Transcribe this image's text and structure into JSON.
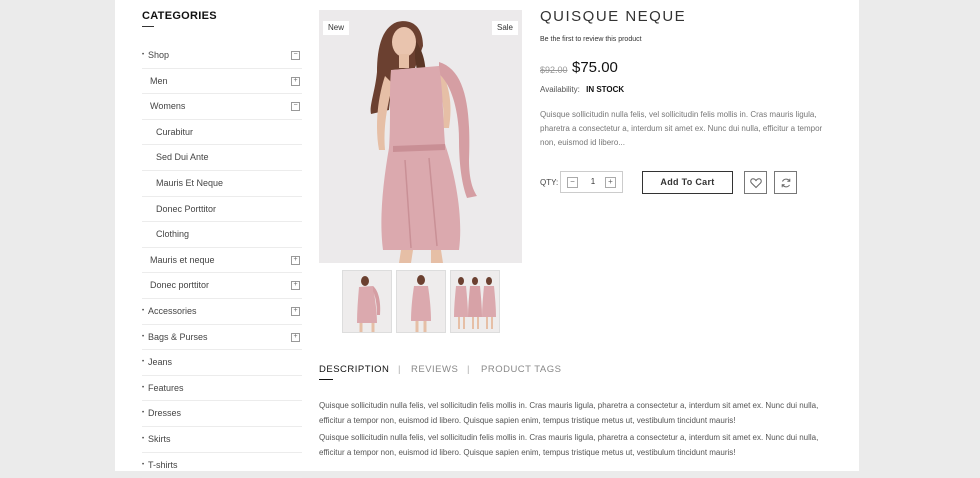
{
  "sidebar": {
    "title": "CATEGORIES",
    "items": [
      {
        "label": "Shop",
        "level": 0,
        "toggle": "minus"
      },
      {
        "label": "Men",
        "level": 1,
        "toggle": "plus"
      },
      {
        "label": "Womens",
        "level": 1,
        "toggle": "minus"
      },
      {
        "label": "Curabitur",
        "level": 2,
        "toggle": ""
      },
      {
        "label": "Sed Dui Ante",
        "level": 2,
        "toggle": ""
      },
      {
        "label": "Mauris Et Neque",
        "level": 2,
        "toggle": ""
      },
      {
        "label": "Donec Porttitor",
        "level": 2,
        "toggle": ""
      },
      {
        "label": "Clothing",
        "level": 2,
        "toggle": ""
      },
      {
        "label": "Mauris et neque",
        "level": 1,
        "toggle": "plus"
      },
      {
        "label": "Donec porttitor",
        "level": 1,
        "toggle": "plus"
      },
      {
        "label": "Accessories",
        "level": 0,
        "toggle": "plus"
      },
      {
        "label": "Bags & Purses",
        "level": 0,
        "toggle": "plus"
      },
      {
        "label": "Jeans",
        "level": 0,
        "toggle": ""
      },
      {
        "label": "Features",
        "level": 0,
        "toggle": ""
      },
      {
        "label": "Dresses",
        "level": 0,
        "toggle": ""
      },
      {
        "label": "Skirts",
        "level": 0,
        "toggle": ""
      },
      {
        "label": "T-shirts",
        "level": 0,
        "toggle": ""
      }
    ]
  },
  "gallery": {
    "badge_new": "New",
    "badge_sale": "Sale",
    "dress_color": "#dba9ae",
    "thumb_count": 3
  },
  "product": {
    "name": "QUISQUE NEQUE",
    "review_link": "Be the first to review this product",
    "old_price": "$92.00",
    "price": "$75.00",
    "availability_label": "Availability:",
    "availability_value": "IN STOCK",
    "short_description": "Quisque sollicitudin nulla felis, vel sollicitudin felis mollis in. Cras mauris ligula, pharetra a consectetur a, interdum sit amet ex. Nunc dui nulla, efficitur a tempor non, euismod id libero...",
    "qty_label": "QTY:",
    "qty_value": "1",
    "add_to_cart": "Add To Cart",
    "wishlist_icon": "heart-icon",
    "compare_icon": "refresh-icon"
  },
  "tabs": {
    "items": [
      "DESCRIPTION",
      "REVIEWS",
      "PRODUCT TAGS"
    ],
    "separator": "|",
    "active": 0,
    "body": [
      "Quisque sollicitudin nulla felis, vel sollicitudin felis mollis in. Cras mauris ligula, pharetra a consectetur a, interdum sit amet ex. Nunc dui nulla, efficitur a tempor non, euismod id libero. Quisque sapien enim, tempus tristique metus ut, vestibulum tincidunt mauris!",
      "Quisque sollicitudin nulla felis, vel sollicitudin felis mollis in. Cras mauris ligula, pharetra a consectetur a, interdum sit amet ex. Nunc dui nulla, efficitur a tempor non, euismod id libero. Quisque sapien enim, tempus tristique metus ut, vestibulum tincidunt mauris!"
    ]
  }
}
